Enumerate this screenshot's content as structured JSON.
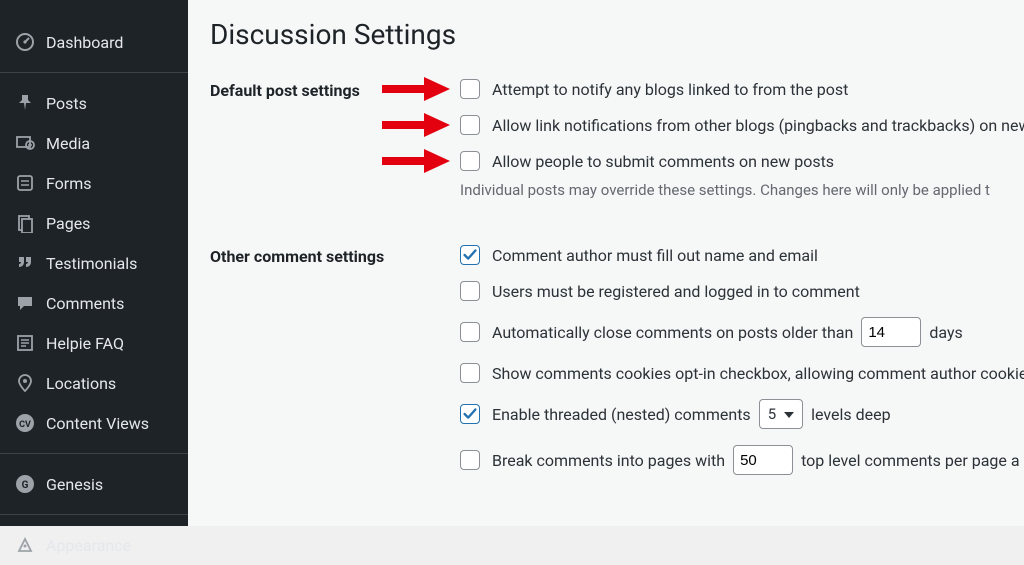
{
  "sidebar": {
    "items": [
      {
        "label": "Dashboard",
        "icon": "dashboard-icon"
      },
      {
        "label": "Posts",
        "icon": "pin-icon"
      },
      {
        "label": "Media",
        "icon": "media-icon"
      },
      {
        "label": "Forms",
        "icon": "forms-icon"
      },
      {
        "label": "Pages",
        "icon": "pages-icon"
      },
      {
        "label": "Testimonials",
        "icon": "quote-icon"
      },
      {
        "label": "Comments",
        "icon": "comment-icon"
      },
      {
        "label": "Helpie FAQ",
        "icon": "faq-icon"
      },
      {
        "label": "Locations",
        "icon": "location-icon"
      },
      {
        "label": "Content Views",
        "icon": "cv-icon"
      },
      {
        "label": "Genesis",
        "icon": "genesis-icon"
      },
      {
        "label": "Appearance",
        "icon": "appearance-icon"
      }
    ]
  },
  "page": {
    "title": "Discussion Settings"
  },
  "sections": {
    "default_post": {
      "heading": "Default post settings",
      "opt1": "Attempt to notify any blogs linked to from the post",
      "opt2": "Allow link notifications from other blogs (pingbacks and trackbacks) on new ",
      "opt3": "Allow people to submit comments on new posts",
      "note": "Individual posts may override these settings. Changes here will only be applied t"
    },
    "other_comment": {
      "heading": "Other comment settings",
      "opt1": "Comment author must fill out name and email",
      "opt2": "Users must be registered and logged in to comment",
      "opt3_a": "Automatically close comments on posts older than",
      "opt3_days_value": "14",
      "opt3_b": "days",
      "opt4": "Show comments cookies opt-in checkbox, allowing comment author cookies",
      "opt5_a": "Enable threaded (nested) comments",
      "opt5_levels_value": "5",
      "opt5_b": "levels deep",
      "opt6_a": "Break comments into pages with",
      "opt6_value": "50",
      "opt6_b": "top level comments per page a"
    }
  }
}
